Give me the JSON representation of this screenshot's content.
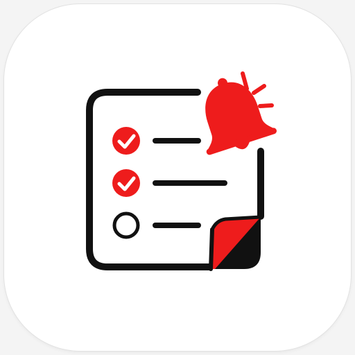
{
  "app_icon": {
    "icon": "reminder-checklist-icon",
    "colors": {
      "accent": "#ee1c1c",
      "ink": "#111111",
      "background": "#ffffff"
    },
    "checklist": {
      "items": [
        {
          "state": "checked",
          "icon": "check-circle-icon"
        },
        {
          "state": "checked",
          "icon": "check-circle-icon"
        },
        {
          "state": "unchecked",
          "icon": "empty-circle-icon"
        }
      ]
    },
    "badge": {
      "icon": "bell-icon",
      "state": "ringing"
    },
    "corner": {
      "icon": "page-curl-icon"
    }
  }
}
